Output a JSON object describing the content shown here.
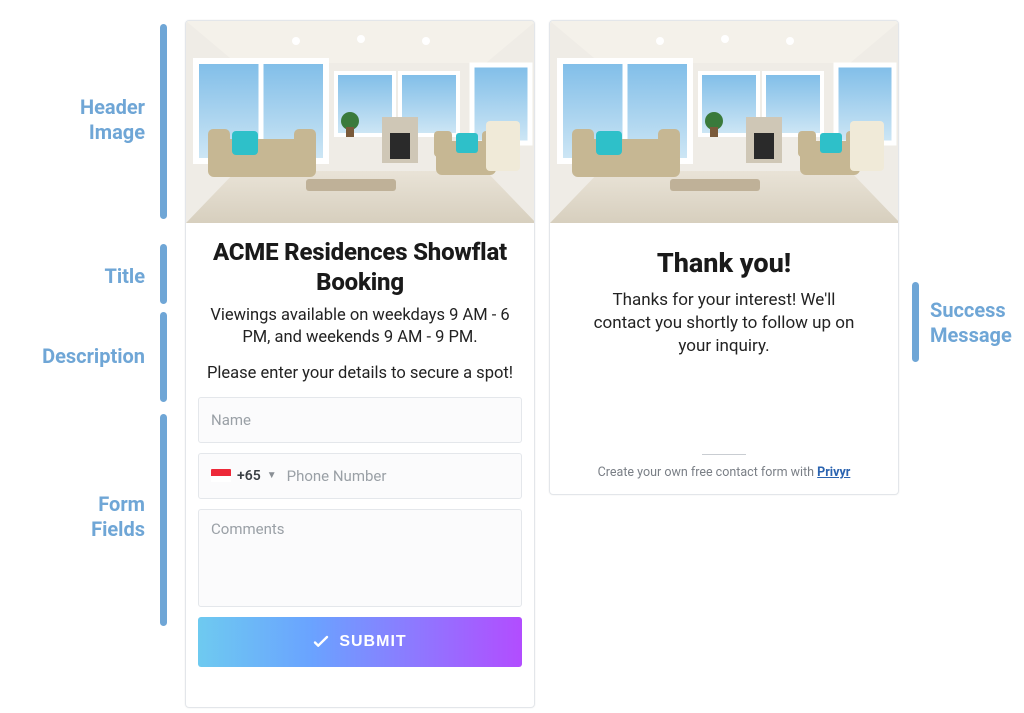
{
  "annotations": {
    "header_image": "Header\nImage",
    "title": "Title",
    "description": "Description",
    "form_fields": "Form\nFields",
    "success_message": "Success\nMessage"
  },
  "form": {
    "title": "ACME Residences Showflat Booking",
    "description": "Viewings available on weekdays 9 AM - 6 PM, and weekends 9 AM - 9 PM.",
    "callout": "Please enter your details to secure a spot!",
    "name_placeholder": "Name",
    "country_code": "+65",
    "phone_placeholder": "Phone Number",
    "comments_placeholder": "Comments",
    "submit_label": "SUBMIT"
  },
  "success": {
    "title": "Thank you!",
    "body": "Thanks for your interest! We'll contact you shortly to follow up on your inquiry.",
    "footer_text": "Create your own free contact form with ",
    "footer_link": "Privyr"
  },
  "colors": {
    "label": "#6fa6d6"
  }
}
